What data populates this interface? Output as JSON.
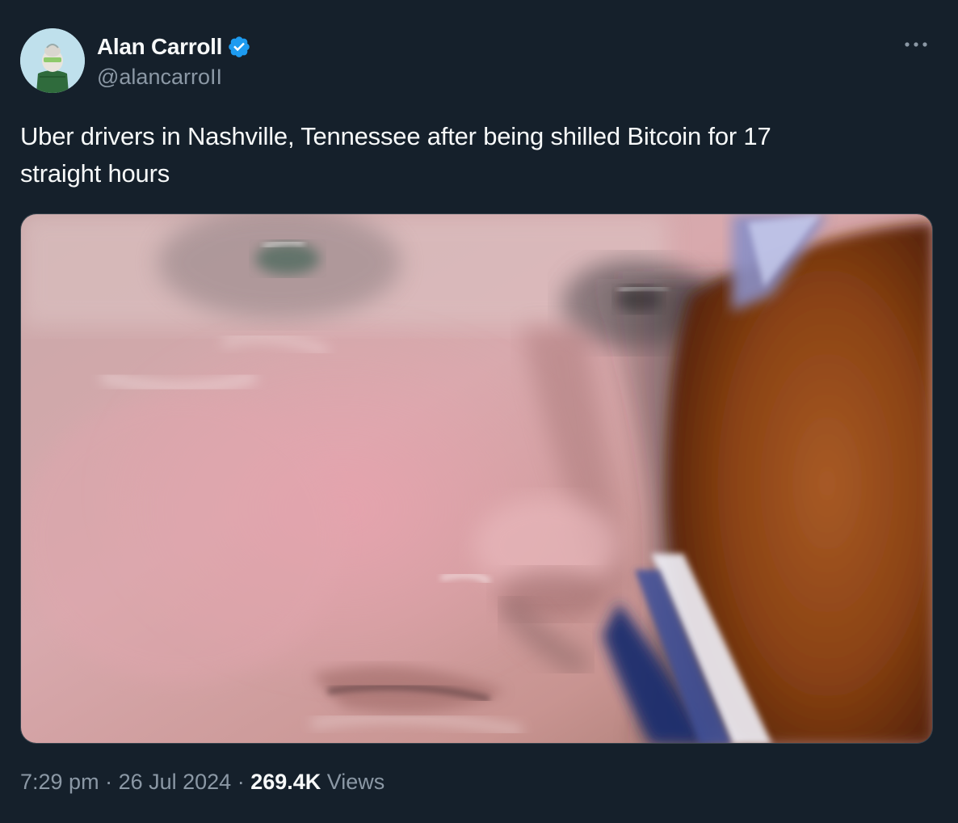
{
  "author": {
    "display_name": "Alan Carroll",
    "handle": "@alancarroII",
    "verified": true,
    "verified_color": "#1d9bf0"
  },
  "tweet": {
    "text_line1": "Uber drivers in Nashville, Tennessee after being shilled Bitcoin for 17",
    "text_line2": "straight hours"
  },
  "meta": {
    "time": "7:29 pm",
    "separator1": " · ",
    "date": "26 Jul 2024",
    "separator2": " · ",
    "views_count": "269.4K",
    "views_label": " Views"
  },
  "icons": {
    "more": "more-options-icon",
    "verified": "verified-badge-icon"
  },
  "colors": {
    "background": "#15202b",
    "secondary_text": "#8b98a5",
    "primary_text": "#f7f9f9",
    "border": "#38444d"
  }
}
